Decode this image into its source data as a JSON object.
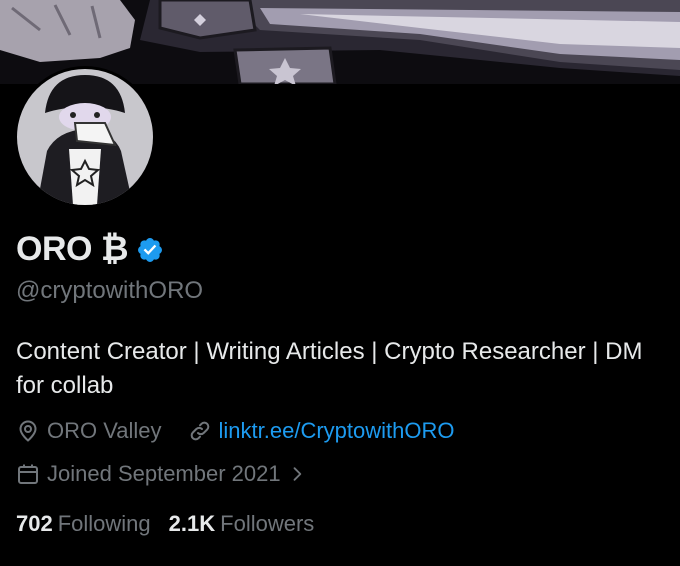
{
  "profile": {
    "name": "ORO ₿",
    "handle": "@cryptowithORO",
    "bio": "Content Creator | Writing Articles | Crypto Researcher | DM for collab",
    "location": "ORO Valley",
    "website": "linktr.ee/CryptowithORO",
    "joined": "Joined September 2021",
    "following_count": "702",
    "following_label": "Following",
    "followers_count": "2.1K",
    "followers_label": "Followers"
  },
  "colors": {
    "background": "#000000",
    "text_primary": "#e7e9ea",
    "text_secondary": "#71767b",
    "link": "#1d9bf0",
    "verified_badge": "#1d9bf0"
  },
  "icons": {
    "verified": "verified-badge-icon",
    "location": "location-pin-icon",
    "link": "link-icon",
    "calendar": "calendar-icon",
    "chevron": "chevron-right-icon"
  }
}
